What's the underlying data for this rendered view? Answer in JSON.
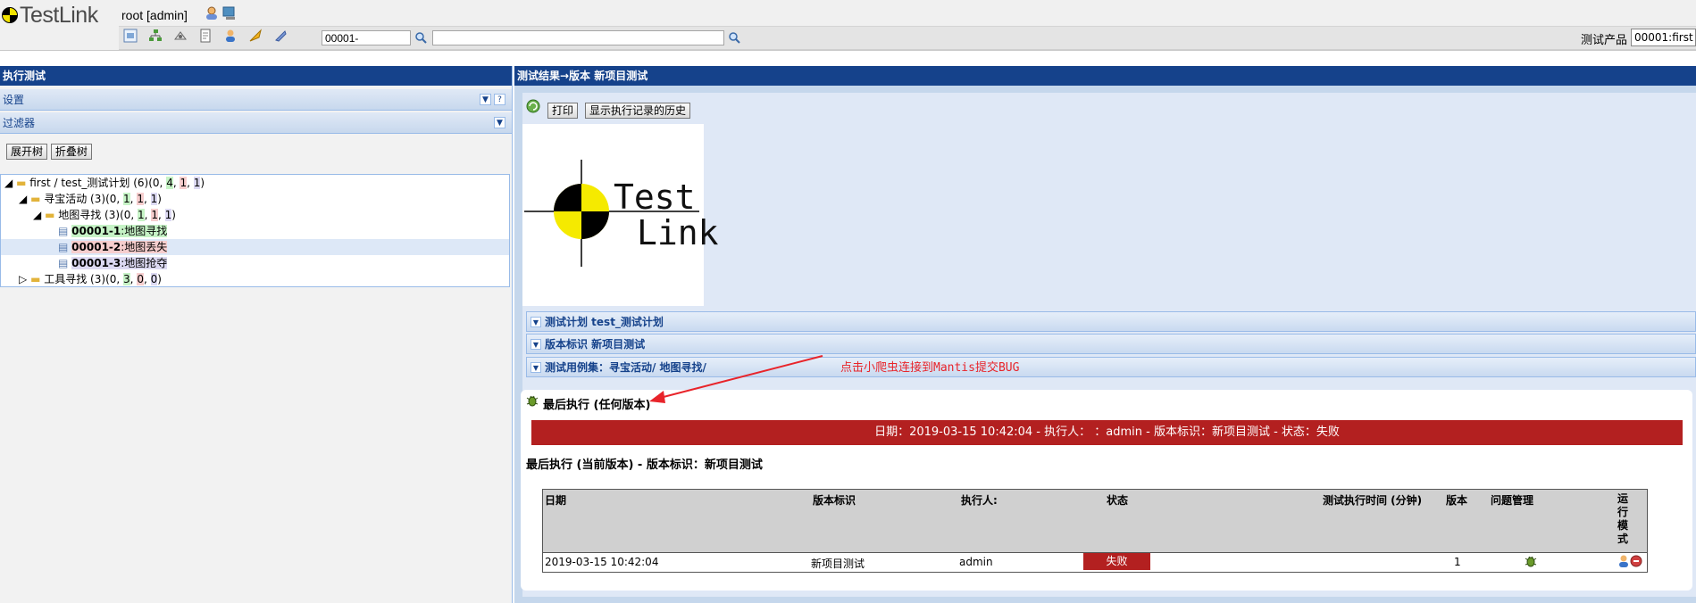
{
  "header": {
    "app_name": "TestLink",
    "user": "root [admin]",
    "search_tc_prefix": "00001-",
    "search_text": "",
    "product_label": "测试产品",
    "product_selected": "00001:first"
  },
  "left": {
    "title": "执行测试",
    "settings": "设置",
    "filters": "过滤器",
    "expand_btn": "展开树",
    "collapse_btn": "折叠树",
    "tree": {
      "root": {
        "label": "first / test_测试计划 (6)",
        "counts": [
          "0",
          "4",
          "1",
          "1"
        ]
      },
      "suite1": {
        "label": "寻宝活动 (3)",
        "counts": [
          "0",
          "1",
          "1",
          "1"
        ]
      },
      "suite1a": {
        "label": "地图寻找 (3)",
        "counts": [
          "0",
          "1",
          "1",
          "1"
        ]
      },
      "tc1": {
        "id": "00001-1",
        "name": ":地图寻找"
      },
      "tc2": {
        "id": "00001-2",
        "name": ":地图丢失"
      },
      "tc3": {
        "id": "00001-3",
        "name": ":地图抢夺"
      },
      "suite2": {
        "label": "工具寻找 (3)",
        "counts": [
          "0",
          "3",
          "0",
          "0"
        ]
      }
    }
  },
  "right": {
    "title": "测试结果→版本 新项目测试",
    "print_btn": "打印",
    "history_btn": "显示执行记录的历史",
    "logo_line1": "Test",
    "logo_line2": "Link",
    "testplan_bar": "测试计划 test_测试计划",
    "build_bar": "版本标识 新项目测试",
    "suite_bar": "测试用例集：寻宝活动/ 地图寻找/",
    "annotation": "点击小爬虫连接到Mantis提交BUG",
    "last_exec_any": "最后执行 (任何版本)",
    "fail_banner": "日期：2019-03-15 10:42:04 - 执行人： ：admin - 版本标识：新项目测试 - 状态：失败",
    "last_exec_current": "最后执行 (当前版本) - 版本标识：新项目测试",
    "table": {
      "headers": {
        "date": "日期",
        "build": "版本标识",
        "tester": "执行人:",
        "status": "状态",
        "duration": "测试执行时间 (分钟)",
        "version": "版本",
        "issue": "问题管理",
        "mode": "运行模式"
      },
      "row": {
        "date": "2019-03-15 10:42:04",
        "build": "新项目测试",
        "tester": "admin",
        "status": "失败",
        "duration": "",
        "version": "1"
      }
    }
  },
  "colors": {
    "panel_title": "#15428b",
    "fail": "#b32020",
    "annotation": "#e8242a"
  }
}
